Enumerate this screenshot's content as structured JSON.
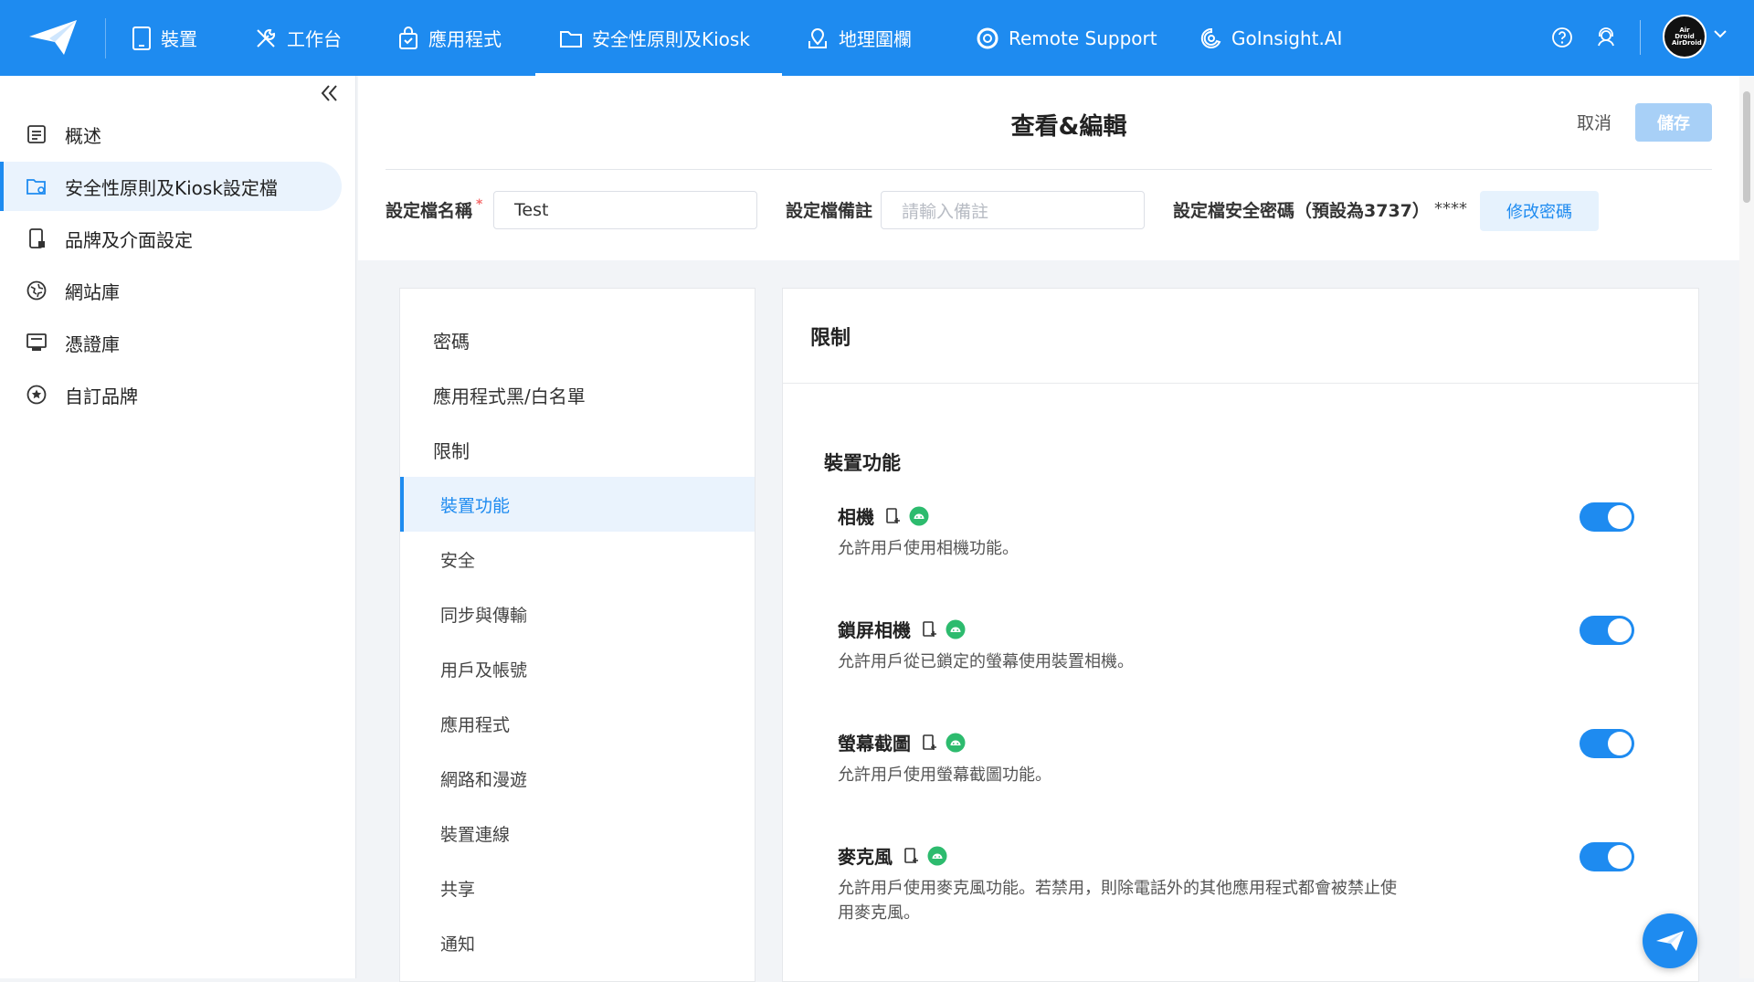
{
  "nav": {
    "items": [
      {
        "label": "裝置",
        "icon": "tablet-icon"
      },
      {
        "label": "工作台",
        "icon": "tools-icon"
      },
      {
        "label": "應用程式",
        "icon": "app-bag-icon"
      },
      {
        "label": "安全性原則及Kiosk",
        "icon": "folder-icon"
      },
      {
        "label": "地理圍欄",
        "icon": "geofence-icon"
      },
      {
        "label": "Remote Support",
        "icon": "lifebuoy-icon"
      },
      {
        "label": "GoInsight.AI",
        "icon": "ai-icon"
      }
    ],
    "active_index": 3,
    "avatar_text": "Air Droid AirDroid",
    "accent": "#1e8bf0"
  },
  "sidebar": {
    "items": [
      {
        "label": "概述",
        "icon": "overview-icon"
      },
      {
        "label": "安全性原則及Kiosk設定檔",
        "icon": "policy-folder-icon"
      },
      {
        "label": "品牌及介面設定",
        "icon": "device-brand-icon"
      },
      {
        "label": "網站庫",
        "icon": "globe-icon"
      },
      {
        "label": "憑證庫",
        "icon": "certificate-icon"
      },
      {
        "label": "自訂品牌",
        "icon": "star-circle-icon"
      }
    ],
    "active_index": 1
  },
  "header": {
    "title": "查看&編輯",
    "cancel_label": "取消",
    "save_label": "儲存",
    "name_label": "設定檔名稱",
    "required_mark": "*",
    "name_value": "Test",
    "note_label": "設定檔備註",
    "note_placeholder": "請輸入備註",
    "password_label": "設定檔安全密碼（預設為3737）",
    "password_mask": "****",
    "change_password_label": "修改密碼"
  },
  "menu": {
    "top_items": [
      "密碼",
      "應用程式黑/白名單",
      "限制"
    ],
    "sub_items": [
      "裝置功能",
      "安全",
      "同步與傳輸",
      "用戶及帳號",
      "應用程式",
      "網路和漫遊",
      "裝置連線",
      "共享",
      "通知"
    ],
    "active_sub_index": 0
  },
  "content": {
    "title": "限制",
    "section_title": "裝置功能",
    "features": [
      {
        "name": "相機",
        "desc": "允許用戶使用相機功能。",
        "enabled": true
      },
      {
        "name": "鎖屏相機",
        "desc": "允許用戶從已鎖定的螢幕使用裝置相機。",
        "enabled": true
      },
      {
        "name": "螢幕截圖",
        "desc": "允許用戶使用螢幕截圖功能。",
        "enabled": true
      },
      {
        "name": "麥克風",
        "desc": "允許用戶使用麥克風功能。若禁用，則除電話外的其他應用程式都會被禁止使用麥克風。",
        "enabled": true
      }
    ]
  }
}
